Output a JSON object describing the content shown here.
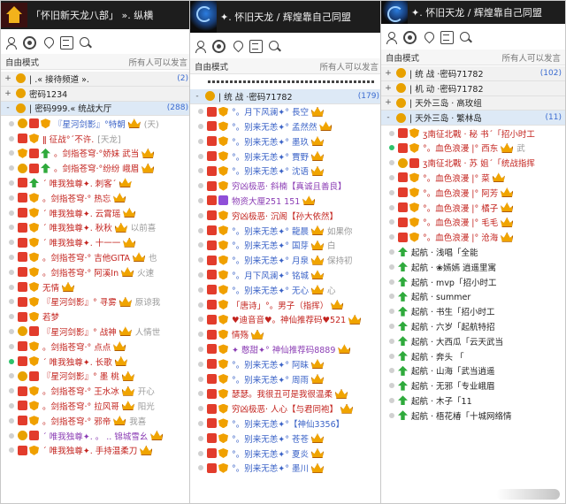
{
  "panels": [
    {
      "title": "「怀旧新天龙八部」 ».  纵横",
      "logo": "home-icon",
      "toolbar_icons": [
        "user-icon",
        "gear-icon",
        "location-pin-icon",
        "notice-board-icon",
        "search-icon"
      ],
      "mode_left": "自由模式",
      "mode_right": "所有人可以发言",
      "rows": [
        {
          "kind": "ch",
          "exp": "+",
          "name": "|       .« 接待频道 ».",
          "count": "(2)",
          "sel": false
        },
        {
          "kind": "ch",
          "exp": "+",
          "name": "密码1234",
          "count": "",
          "sel": false
        },
        {
          "kind": "ch",
          "exp": "-",
          "name": "| 密码999.« 统战大厅",
          "count": "(288)",
          "sel": true
        },
        {
          "kind": "user",
          "on": false,
          "b": [
            "bs",
            "bv",
            "bsh"
          ],
          "name": "『星河剑影』°特朝",
          "color": "blue",
          "extra": "(天)",
          "crown": true
        },
        {
          "kind": "user",
          "on": false,
          "b": [
            "bv",
            "bsh"
          ],
          "name": "ǁ 征战°ˊ不许.",
          "color": "red",
          "extra": "[天龙]",
          "crown": false
        },
        {
          "kind": "user",
          "on": false,
          "b": [
            "bsh",
            "bv",
            "bt"
          ],
          "name": "。剑指苍穹·°娇妹 武当",
          "color": "red",
          "extra": "",
          "crown": true
        },
        {
          "kind": "user",
          "on": false,
          "b": [
            "bs",
            "bv",
            "bt"
          ],
          "name": "。剑指苍穹·°纷纷 峨眉",
          "color": "red",
          "extra": "",
          "crown": true
        },
        {
          "kind": "user",
          "on": false,
          "b": [
            "bv",
            "bt"
          ],
          "name": "ˊ 唯我独尊✦. 刺客ˊ",
          "color": "red",
          "extra": "",
          "crown": true
        },
        {
          "kind": "user",
          "on": false,
          "b": [
            "bv",
            "bsh"
          ],
          "name": "。剑指苍穹·° 热忘",
          "color": "red",
          "extra": "",
          "crown": true
        },
        {
          "kind": "user",
          "on": false,
          "b": [
            "bv",
            "bsh"
          ],
          "name": "ˊ 唯我独尊✦. 云霄瑶",
          "color": "red",
          "extra": "",
          "crown": true
        },
        {
          "kind": "user",
          "on": false,
          "b": [
            "bv",
            "bsh"
          ],
          "name": "ˊ 唯我独尊✦. 秋秋",
          "color": "red",
          "extra": "以前喜",
          "crown": true
        },
        {
          "kind": "user",
          "on": false,
          "b": [
            "bv",
            "bsh"
          ],
          "name": "ˊ 唯我独尊✦. 十一一",
          "color": "red",
          "extra": "",
          "crown": true
        },
        {
          "kind": "user",
          "on": false,
          "b": [
            "bv",
            "bsh"
          ],
          "name": "。剑指苍穹·° 吉他GITA",
          "color": "red",
          "extra": "也",
          "crown": true
        },
        {
          "kind": "user",
          "on": false,
          "b": [
            "bv",
            "bsh"
          ],
          "name": "。剑指苍穹·° 阿溪In",
          "color": "red",
          "extra": "火速",
          "crown": true
        },
        {
          "kind": "user",
          "on": false,
          "b": [
            "bv",
            "bsh"
          ],
          "name": "无情",
          "color": "red",
          "extra": "",
          "crown": true
        },
        {
          "kind": "user",
          "on": false,
          "b": [
            "bv",
            "bsh"
          ],
          "name": "『星河剑影』° 寻雾",
          "color": "red",
          "extra": "原谅我",
          "crown": true
        },
        {
          "kind": "user",
          "on": false,
          "b": [
            "bv",
            "bsh"
          ],
          "name": "若梦",
          "color": "red",
          "extra": "",
          "crown": false
        },
        {
          "kind": "user",
          "on": false,
          "b": [
            "bs",
            "bv"
          ],
          "name": "『星河剑影』° 战神",
          "color": "red",
          "extra": "人情世",
          "crown": true
        },
        {
          "kind": "user",
          "on": false,
          "b": [
            "bv",
            "bsh"
          ],
          "name": "。剑指苍穹·° 点点",
          "color": "red",
          "extra": "",
          "crown": true
        },
        {
          "kind": "user",
          "on": true,
          "b": [
            "bv",
            "bsh"
          ],
          "name": "ˊ 唯我独尊✦. 长歌",
          "color": "red",
          "extra": "",
          "crown": true
        },
        {
          "kind": "user",
          "on": false,
          "b": [
            "bs",
            "bv"
          ],
          "name": "『星河剑影』° 墨 桃",
          "color": "red",
          "extra": "",
          "crown": true
        },
        {
          "kind": "user",
          "on": false,
          "b": [
            "bv",
            "bsh"
          ],
          "name": "。剑指苍穹·° 王水冰",
          "color": "red",
          "extra": "开心",
          "crown": true
        },
        {
          "kind": "user",
          "on": false,
          "b": [
            "bv",
            "bsh"
          ],
          "name": "。剑指苍穹·° 拉风哥",
          "color": "red",
          "extra": "阳光",
          "crown": true
        },
        {
          "kind": "user",
          "on": false,
          "b": [
            "bv",
            "bsh"
          ],
          "name": "。剑指苍穹·° 邪帝",
          "color": "red",
          "extra": "我喜",
          "crown": true
        },
        {
          "kind": "user",
          "on": false,
          "b": [
            "bs",
            "bv"
          ],
          "name": "ˊ 唯我独尊✦. 。 .. 锦城雪幺",
          "color": "purple",
          "extra": "",
          "crown": true
        },
        {
          "kind": "user",
          "on": false,
          "b": [
            "bv",
            "bsh"
          ],
          "name": "ˊ 唯我独尊✦. 手持温柔刀",
          "color": "red",
          "extra": "",
          "crown": true
        }
      ]
    },
    {
      "title": "✦. 怀旧天龙 / 辉煌靠自己同盟",
      "logo": "swirl-logo-icon",
      "toolbar_icons": [
        "user-icon",
        "gear-icon",
        "location-pin-icon",
        "notice-board-icon",
        "search-icon"
      ],
      "mode_left": "自由模式",
      "mode_right": "所有人可以发言",
      "rows": [
        {
          "kind": "ch",
          "exp": "-",
          "name": "| 统 战  ·密码71782",
          "count": "(179)",
          "sel": true
        },
        {
          "kind": "user",
          "on": false,
          "b": [
            "bv",
            "bsh"
          ],
          "name": "°。月下风澜✦° 長空",
          "color": "blue",
          "extra": "",
          "crown": true
        },
        {
          "kind": "user",
          "on": false,
          "b": [
            "bv",
            "bsh"
          ],
          "name": "°。别来无恙✦° 孟然然",
          "color": "blue",
          "extra": "",
          "crown": true
        },
        {
          "kind": "user",
          "on": false,
          "b": [
            "bv",
            "bsh"
          ],
          "name": "°。别来无恙✦° 墨玖",
          "color": "blue",
          "extra": "",
          "crown": true
        },
        {
          "kind": "user",
          "on": false,
          "b": [
            "bv",
            "bsh"
          ],
          "name": "°。别来无恙✦° 賈野",
          "color": "blue",
          "extra": "",
          "crown": true
        },
        {
          "kind": "user",
          "on": false,
          "b": [
            "bv",
            "bsh"
          ],
          "name": "°。别来无恙✦° 沈语",
          "color": "blue",
          "extra": "",
          "crown": true
        },
        {
          "kind": "user",
          "on": false,
          "b": [
            "bv",
            "bsh"
          ],
          "name": "穷凶极恶· 斜楠【真诚且善良】",
          "color": "purple",
          "extra": "",
          "crown": false
        },
        {
          "kind": "user",
          "on": false,
          "b": [
            "bv",
            "bp"
          ],
          "name": "物资大厘251 151",
          "color": "purple",
          "extra": "",
          "crown": true
        },
        {
          "kind": "user",
          "on": false,
          "b": [
            "bv",
            "bsh"
          ],
          "name": "穷凶极恶· 沉阁【孙大依然】",
          "color": "red",
          "extra": "",
          "crown": false
        },
        {
          "kind": "user",
          "on": false,
          "b": [
            "bv",
            "bsh"
          ],
          "name": "°。别来无恙✦° 龍晨",
          "color": "blue",
          "extra": "如果你",
          "crown": true
        },
        {
          "kind": "user",
          "on": false,
          "b": [
            "bv",
            "bsh"
          ],
          "name": "°。别来无恙✦° 国芽",
          "color": "blue",
          "extra": "白",
          "crown": true
        },
        {
          "kind": "user",
          "on": false,
          "b": [
            "bv",
            "bsh"
          ],
          "name": "°。别来无恙✦° 月泉",
          "color": "blue",
          "extra": "保持初",
          "crown": true
        },
        {
          "kind": "user",
          "on": false,
          "b": [
            "bv",
            "bsh"
          ],
          "name": "°。月下风澜✦° 铭城",
          "color": "blue",
          "extra": "",
          "crown": true
        },
        {
          "kind": "user",
          "on": false,
          "b": [
            "bv",
            "bsh"
          ],
          "name": "°。别来无恙✦° 无心",
          "color": "blue",
          "extra": "心",
          "crown": true
        },
        {
          "kind": "user",
          "on": false,
          "b": [
            "bv",
            "bsh"
          ],
          "name": "「唐诗」°。男子（指挥）",
          "color": "red",
          "extra": "",
          "crown": true
        },
        {
          "kind": "user",
          "on": false,
          "b": [
            "bv",
            "bsh"
          ],
          "name": "♥迪音音♥。神仙推荐码♥521",
          "color": "red",
          "extra": "",
          "crown": true
        },
        {
          "kind": "user",
          "on": false,
          "b": [
            "bv",
            "bsh"
          ],
          "name": "情殇",
          "color": "red",
          "extra": "",
          "crown": true
        },
        {
          "kind": "user",
          "on": false,
          "b": [
            "bv",
            "bsh"
          ],
          "name": "✦ 憨甜✦° 神仙推荐码8889",
          "color": "purple",
          "extra": "",
          "crown": true
        },
        {
          "kind": "user",
          "on": false,
          "b": [
            "bv",
            "bsh"
          ],
          "name": "°。别来无恙✦° 阿昧",
          "color": "blue",
          "extra": "",
          "crown": true
        },
        {
          "kind": "user",
          "on": false,
          "b": [
            "bv",
            "bsh"
          ],
          "name": "°。别来无恙✦° 周雨",
          "color": "blue",
          "extra": "",
          "crown": true
        },
        {
          "kind": "user",
          "on": false,
          "b": [
            "bv",
            "bsh"
          ],
          "name": "瑟瑟。我很丑可是我很温柔",
          "color": "red",
          "extra": "",
          "crown": true
        },
        {
          "kind": "user",
          "on": false,
          "b": [
            "bv",
            "bsh"
          ],
          "name": "穷凶极恶· 人心【与君同袍】",
          "color": "red",
          "extra": "",
          "crown": true
        },
        {
          "kind": "user",
          "on": false,
          "b": [
            "bv",
            "bsh"
          ],
          "name": "°。别来无恙✦°【神仙3356】",
          "color": "blue",
          "extra": "",
          "crown": false
        },
        {
          "kind": "user",
          "on": false,
          "b": [
            "bv",
            "bsh"
          ],
          "name": "°。别来无恙✦° 苍苍",
          "color": "blue",
          "extra": "",
          "crown": true
        },
        {
          "kind": "user",
          "on": false,
          "b": [
            "bv",
            "bsh"
          ],
          "name": "°。别来无恙✦° 夏炎",
          "color": "blue",
          "extra": "",
          "crown": true
        },
        {
          "kind": "user",
          "on": false,
          "b": [
            "bv",
            "bsh"
          ],
          "name": "°。别来无恙✦° 墨川",
          "color": "blue",
          "extra": "",
          "crown": true
        }
      ]
    },
    {
      "title": "✦. 怀旧天龙 / 辉煌靠自己同盟",
      "logo": "swirl-logo-icon",
      "toolbar_icons": [
        "user-icon",
        "gear-icon",
        "location-pin-icon",
        "notice-board-icon",
        "search-icon"
      ],
      "mode_left": "自由模式",
      "mode_right": "所有人可以发言",
      "rows": [
        {
          "kind": "ch",
          "exp": "+",
          "name": "| 统 战  ·密码71782",
          "count": "(102)",
          "sel": false
        },
        {
          "kind": "ch",
          "exp": "+",
          "name": "|  机 动  ·密码71782",
          "count": "",
          "sel": false
        },
        {
          "kind": "ch",
          "exp": "+",
          "name": "|  天外三岛 · 高玫组",
          "count": "",
          "sel": false
        },
        {
          "kind": "ch",
          "exp": "-",
          "name": "|  天外三岛 · 繁林岛",
          "count": "(11)",
          "sel": true
        },
        {
          "kind": "user",
          "on": false,
          "b": [
            "bv",
            "bsh"
          ],
          "name": "ʒ南征北戰 · 秘 书ˊ「招小时工",
          "color": "red",
          "extra": "",
          "crown": false
        },
        {
          "kind": "user",
          "on": true,
          "b": [
            "bv",
            "bsh"
          ],
          "name": "°。血色浪漫 |° 西东",
          "color": "red",
          "extra": "武",
          "crown": true
        },
        {
          "kind": "user",
          "on": false,
          "b": [
            "bs",
            "bv"
          ],
          "name": "ʒ南征北戰 · 苏 姐ˊ「统战指挥",
          "color": "red",
          "extra": "",
          "crown": false
        },
        {
          "kind": "user",
          "on": false,
          "b": [
            "bv",
            "bsh"
          ],
          "name": "°。血色浪漫 |° 菜",
          "color": "red",
          "extra": "",
          "crown": true
        },
        {
          "kind": "user",
          "on": false,
          "b": [
            "bv",
            "bsh"
          ],
          "name": "°。血色浪漫 |° 阿芳",
          "color": "red",
          "extra": "",
          "crown": true
        },
        {
          "kind": "user",
          "on": false,
          "b": [
            "bv",
            "bsh"
          ],
          "name": "°。血色浪漫 |° 橘子",
          "color": "red",
          "extra": "",
          "crown": true
        },
        {
          "kind": "user",
          "on": false,
          "b": [
            "bv",
            "bsh"
          ],
          "name": "°。血色浪漫 |° 毛毛",
          "color": "red",
          "extra": "",
          "crown": true
        },
        {
          "kind": "user",
          "on": false,
          "b": [
            "bv",
            "bsh"
          ],
          "name": "°。血色浪漫 |° 沧海",
          "color": "red",
          "extra": "",
          "crown": true
        },
        {
          "kind": "user",
          "on": false,
          "b": [
            "bt"
          ],
          "name": "起航 · 浅唱「全能",
          "color": "black",
          "extra": "",
          "crown": false
        },
        {
          "kind": "user",
          "on": false,
          "b": [
            "bt"
          ],
          "name": "起航 · ❀嫣嫣 逍遥里寓",
          "color": "black",
          "extra": "",
          "crown": false
        },
        {
          "kind": "user",
          "on": false,
          "b": [
            "bt"
          ],
          "name": "起航 · mvp「招小时工",
          "color": "black",
          "extra": "",
          "crown": false
        },
        {
          "kind": "user",
          "on": false,
          "b": [
            "bt"
          ],
          "name": "起航 · summer",
          "color": "black",
          "extra": "",
          "crown": false
        },
        {
          "kind": "user",
          "on": false,
          "b": [
            "bt"
          ],
          "name": "起航 · 书生「招小时工",
          "color": "black",
          "extra": "",
          "crown": false
        },
        {
          "kind": "user",
          "on": false,
          "b": [
            "bt"
          ],
          "name": "起航 · 六岁「起航特招",
          "color": "black",
          "extra": "",
          "crown": false
        },
        {
          "kind": "user",
          "on": false,
          "b": [
            "bt"
          ],
          "name": "起航 · 大西瓜「云天武当",
          "color": "black",
          "extra": "",
          "crown": false
        },
        {
          "kind": "user",
          "on": false,
          "b": [
            "bt"
          ],
          "name": "起航 · 奔头 「",
          "color": "black",
          "extra": "",
          "crown": false
        },
        {
          "kind": "user",
          "on": false,
          "b": [
            "bt"
          ],
          "name": "起航 · 山海「武当逍遥",
          "color": "black",
          "extra": "",
          "crown": false
        },
        {
          "kind": "user",
          "on": false,
          "b": [
            "bt"
          ],
          "name": "起航 · 无邪「专业峨眉",
          "color": "black",
          "extra": "",
          "crown": false
        },
        {
          "kind": "user",
          "on": false,
          "b": [
            "bt"
          ],
          "name": "起航 · 木子「11",
          "color": "black",
          "extra": "",
          "crown": false
        },
        {
          "kind": "user",
          "on": false,
          "b": [
            "bt"
          ],
          "name": "起航 · 梧花椿「十城网络情",
          "color": "black",
          "extra": "",
          "crown": false
        }
      ]
    }
  ]
}
